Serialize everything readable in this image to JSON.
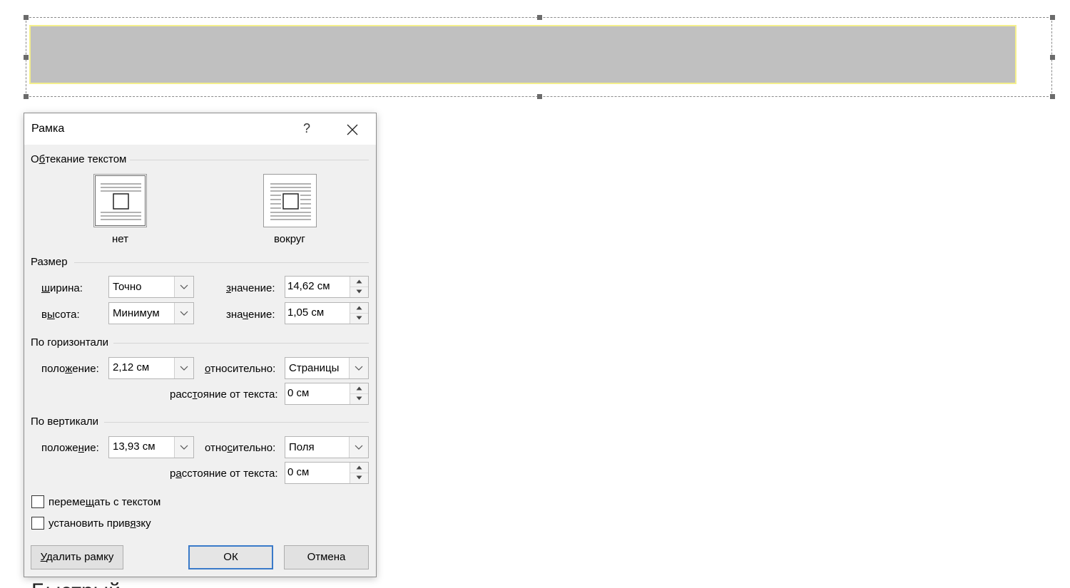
{
  "document": {
    "partial_text": "Быстрый"
  },
  "dialog": {
    "title": "Рамка",
    "help_label": "?",
    "wrapping": {
      "section_label_pre": "О",
      "section_label_ul": "б",
      "section_label_post": "текание текстом",
      "options": [
        {
          "label": "нет",
          "selected": true
        },
        {
          "label": "вокруг",
          "selected": false
        }
      ]
    },
    "size": {
      "section_label": "Размер",
      "width_label_ul": "ш",
      "width_label_post": "ирина:",
      "width_mode": "Точно",
      "width_value_label_ul": "з",
      "width_value_label_post": "начение:",
      "width_value": "14,62 см",
      "height_label_pre": "в",
      "height_label_ul": "ы",
      "height_label_post": "сота:",
      "height_mode": "Минимум",
      "height_value_label_pre": "зна",
      "height_value_label_ul": "ч",
      "height_value_label_post": "ение:",
      "height_value": "1,05 см"
    },
    "horizontal": {
      "section_label": "По горизонтали",
      "position_label_pre": "поло",
      "position_label_ul": "ж",
      "position_label_post": "ение:",
      "position_value": "2,12 см",
      "relative_label_ul": "о",
      "relative_label_post": "тносительно:",
      "relative_value": "Страницы",
      "distance_label_pre": "расс",
      "distance_label_ul": "т",
      "distance_label_post": "ояние от текста:",
      "distance_value": "0 см"
    },
    "vertical": {
      "section_label": "По вертикали",
      "position_label_pre": "положе",
      "position_label_ul": "н",
      "position_label_post": "ие:",
      "position_value": "13,93 см",
      "relative_label_pre": "отно",
      "relative_label_ul": "с",
      "relative_label_post": "ительно:",
      "relative_value": "Поля",
      "distance_label_pre": "р",
      "distance_label_ul": "а",
      "distance_label_post": "сстояние от текста:",
      "distance_value": "0 см"
    },
    "checkboxes": {
      "move_with_text_pre": "переме",
      "move_with_text_ul": "щ",
      "move_with_text_post": "ать с текстом",
      "move_with_text_checked": false,
      "lock_anchor_pre": "установить прив",
      "lock_anchor_ul": "я",
      "lock_anchor_post": "зку",
      "lock_anchor_checked": false
    },
    "buttons": {
      "remove_frame_ul": "У",
      "remove_frame_post": "далить рамку",
      "ok": "ОК",
      "cancel": "Отмена"
    }
  },
  "colors": {
    "accent": "#3a7ac9",
    "frame_fill": "#c0c0c0",
    "frame_border": "#f4ef8c"
  }
}
